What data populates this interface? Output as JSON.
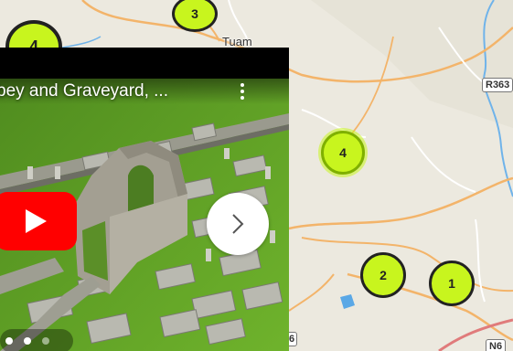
{
  "map": {
    "towns": [
      {
        "name": "Tuam"
      }
    ],
    "road_labels": [
      {
        "text": "R363"
      },
      {
        "text": "N6"
      },
      {
        "text": "6"
      }
    ],
    "clusters": [
      {
        "count": "3"
      },
      {
        "count": "4"
      },
      {
        "count": "4"
      },
      {
        "count": "2"
      },
      {
        "count": "1"
      }
    ],
    "colors": {
      "cluster_fill": "#c8f51e",
      "water": "#5aa8e6",
      "road": "#f3b46a"
    }
  },
  "video": {
    "title": "bey and Graveyard, ...",
    "play_icon": "youtube-play-icon",
    "next_icon": "chevron-right-icon",
    "more_icon": "more-vertical-icon"
  }
}
